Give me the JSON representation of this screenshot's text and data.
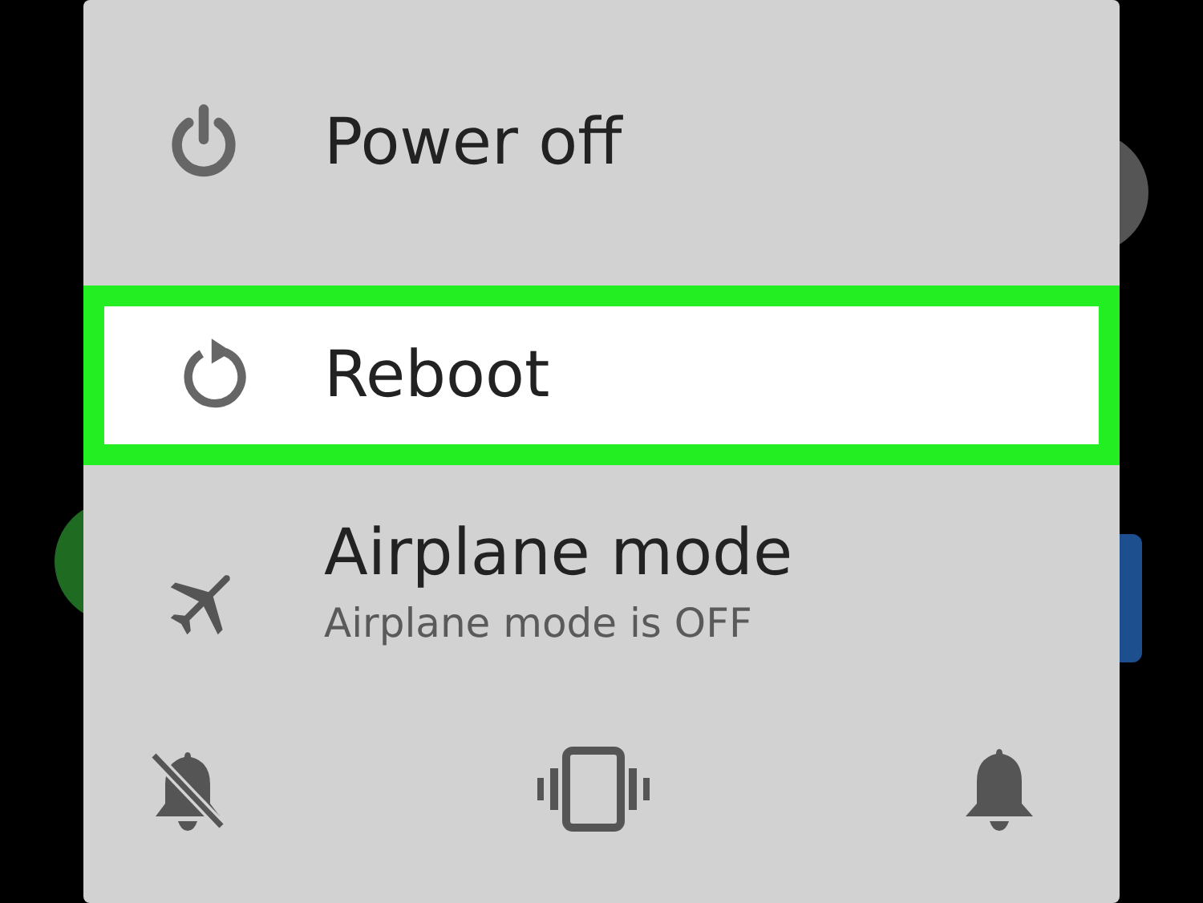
{
  "menu": [
    {
      "kind": "power",
      "label": "Power off",
      "selected": false
    },
    {
      "kind": "reboot",
      "label": "Reboot",
      "selected": true
    },
    {
      "kind": "airplane",
      "label": "Airplane mode",
      "status": "Airplane mode is OFF",
      "selected": false
    }
  ],
  "sound_modes": [
    {
      "kind": "mute"
    },
    {
      "kind": "vibrate"
    },
    {
      "kind": "sound"
    }
  ]
}
